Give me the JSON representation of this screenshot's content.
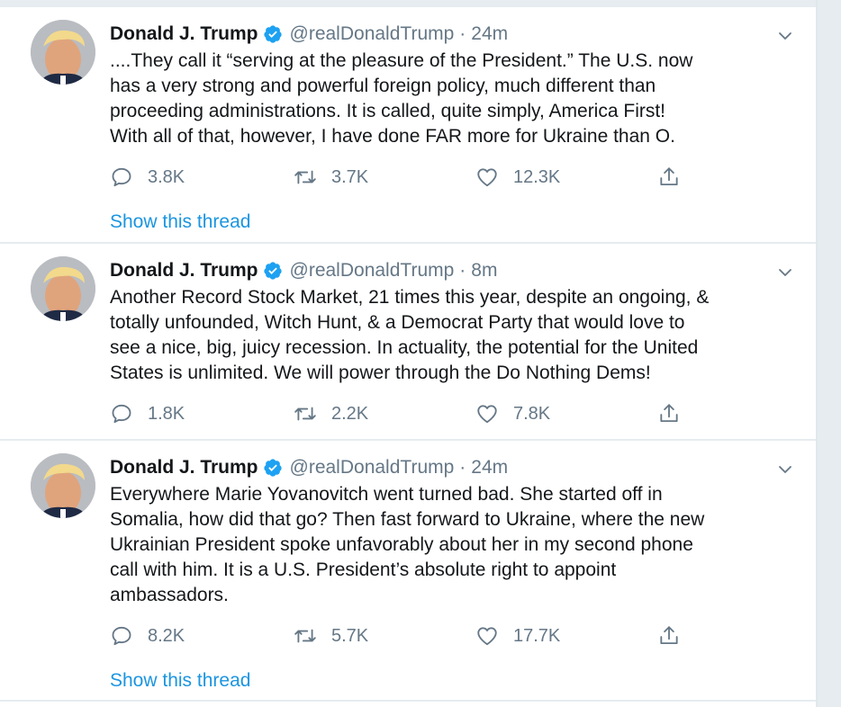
{
  "tweets": [
    {
      "name": "Donald J. Trump",
      "handle": "@realDonaldTrump",
      "separator": "·",
      "time": "24m",
      "text": "....They call it “serving at the pleasure of the President.” The U.S. now\nhas a very strong and powerful foreign policy, much different than\nproceeding administrations. It is called, quite simply, America First!\nWith all of that, however, I have done FAR more for Ukraine than O.",
      "replies": "3.8K",
      "retweets": "3.7K",
      "likes": "12.3K",
      "show_thread": "Show this thread"
    },
    {
      "name": "Donald J. Trump",
      "handle": "@realDonaldTrump",
      "separator": "·",
      "time": "8m",
      "text": "Another Record Stock Market, 21 times this year, despite an ongoing, &\ntotally unfounded, Witch Hunt, & a Democrat Party that would love to\nsee a nice, big, juicy recession. In actuality, the potential for the United\nStates is unlimited. We will power through the Do Nothing Dems!",
      "replies": "1.8K",
      "retweets": "2.2K",
      "likes": "7.8K"
    },
    {
      "name": "Donald J. Trump",
      "handle": "@realDonaldTrump",
      "separator": "·",
      "time": "24m",
      "text": "Everywhere Marie Yovanovitch went turned bad. She started off in\nSomalia, how did that go? Then fast forward to Ukraine, where the new\nUkrainian President spoke unfavorably about her in my second phone\ncall with him. It is a U.S. President’s absolute right to appoint\nambassadors.",
      "replies": "8.2K",
      "retweets": "5.7K",
      "likes": "17.7K",
      "show_thread": "Show this thread"
    }
  ],
  "icons": {
    "verified": "verified-badge-icon",
    "caret": "chevron-down-icon",
    "reply": "reply-icon",
    "retweet": "retweet-icon",
    "like": "heart-icon",
    "share": "share-icon"
  },
  "colors": {
    "accent": "#1b95e0",
    "verified": "#1da1f2",
    "muted": "#657786",
    "text": "#14171a",
    "divider": "#e6ecf0"
  }
}
